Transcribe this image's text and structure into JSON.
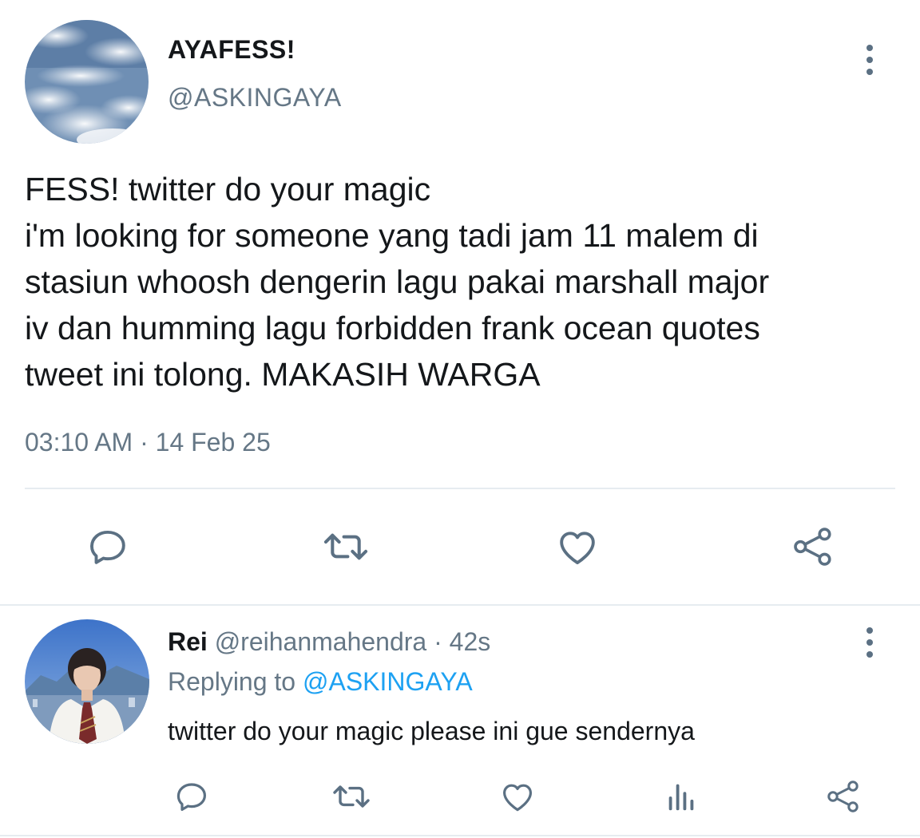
{
  "main_tweet": {
    "display_name": "AYAFESS!",
    "handle": "@ASKINGAYA",
    "text_lines": [
      "FESS! twitter do your magic",
      "i'm looking for someone yang tadi jam 11 malem di",
      "stasiun whoosh dengerin lagu pakai marshall major",
      "iv dan humming lagu forbidden frank ocean quotes",
      "tweet ini tolong. MAKASIH WARGA"
    ],
    "timestamp": "03:10 AM · 14 Feb 25",
    "actions": [
      "reply-icon",
      "retweet-icon",
      "like-icon",
      "share-icon"
    ]
  },
  "reply_tweet": {
    "display_name": "Rei",
    "handle_meta": "@reihanmahendra · 42s",
    "replying_prefix": "Replying to ",
    "replying_mention": "@ASKINGAYA",
    "text": "twitter do your magic please ini gue sendernya",
    "actions": [
      "reply-icon",
      "retweet-icon",
      "like-icon",
      "analytics-icon",
      "share-icon"
    ]
  },
  "colors": {
    "text_primary": "#14171a",
    "text_secondary": "#657786",
    "icon": "#5b7083",
    "link": "#1da1f2",
    "divider": "#e6ecf0"
  }
}
